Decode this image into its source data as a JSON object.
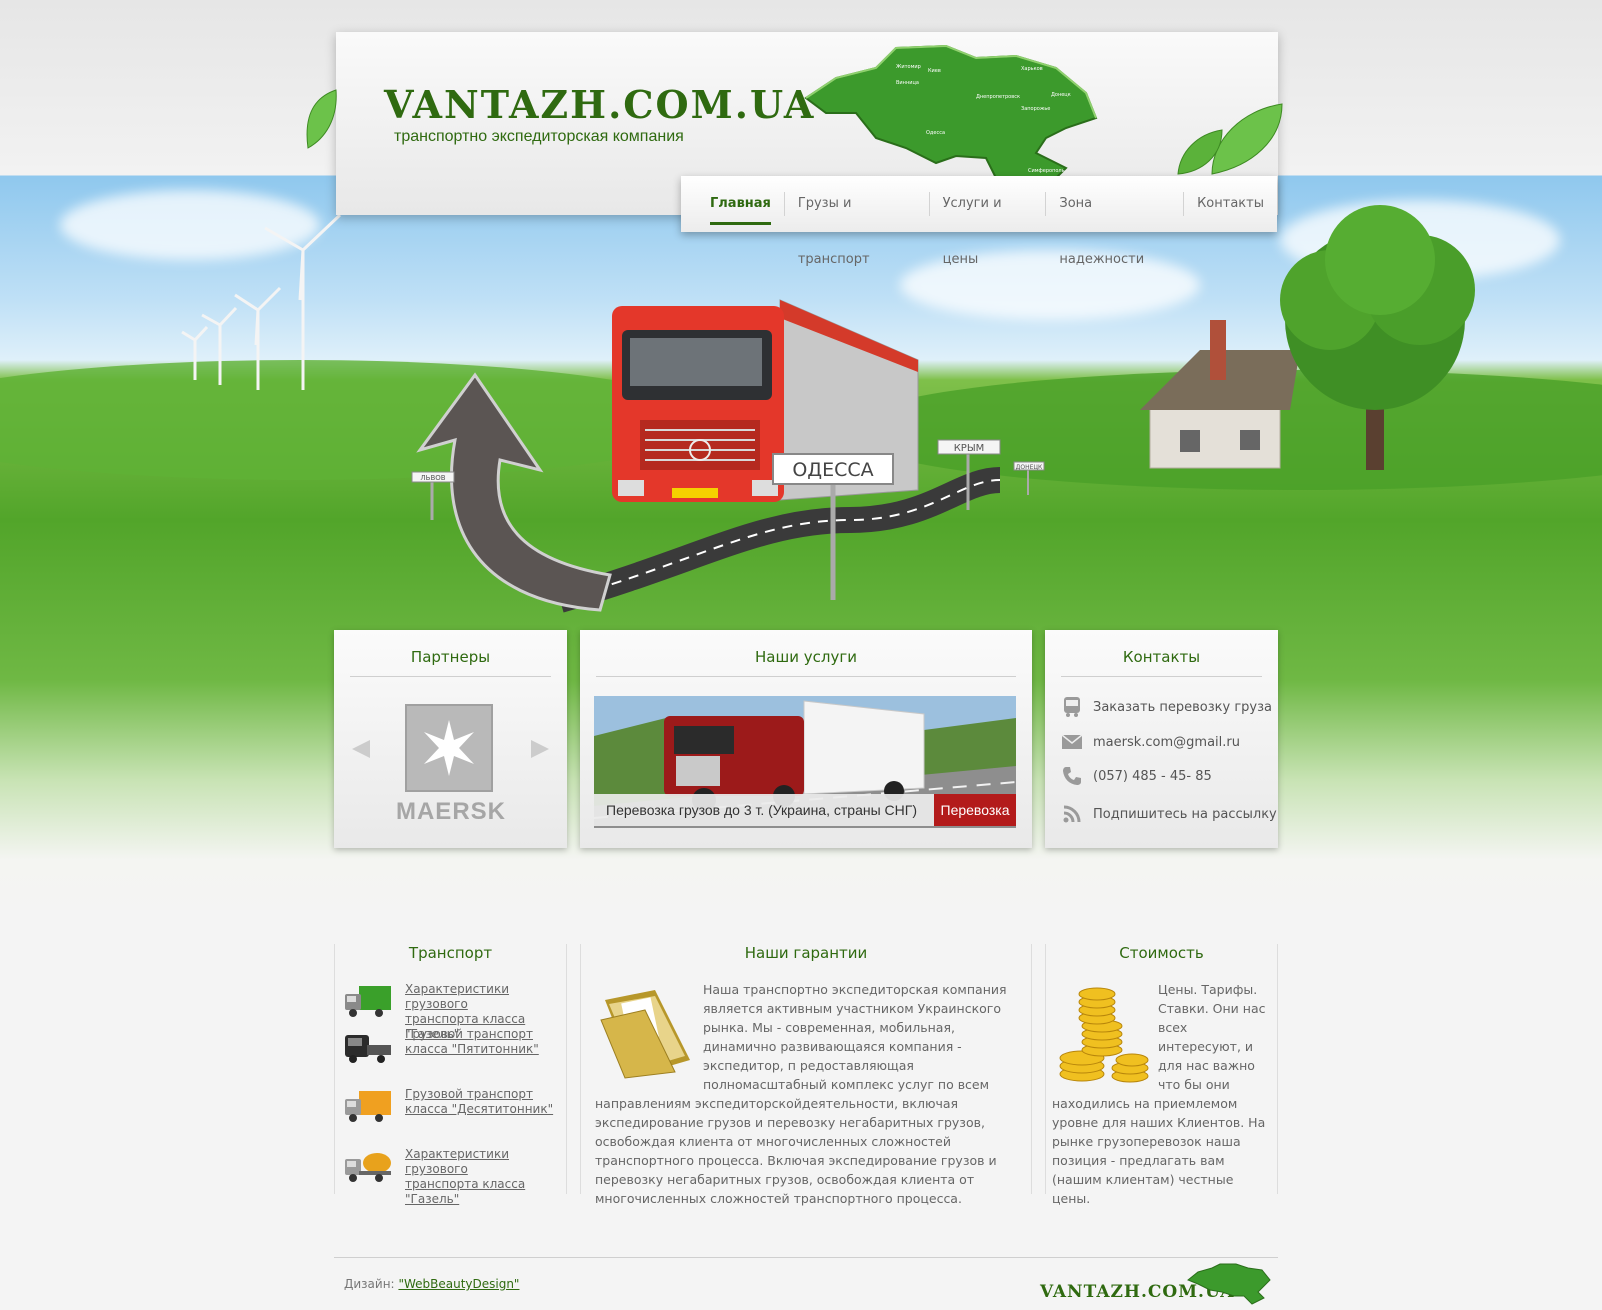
{
  "header": {
    "logo": "VANTAZH.COM.UA",
    "tagline": "транспортно экспедиторская компания",
    "map_labels": [
      "Житомир",
      "Киев",
      "Винница",
      "Одесса",
      "Днепропетровск",
      "Запорожье",
      "Донецк",
      "Харьков",
      "Симферополь"
    ]
  },
  "nav": {
    "items": [
      "Главная",
      "Грузы и транспорт",
      "Услуги и цены",
      "Зона надежности",
      "Контакты"
    ],
    "active_index": 0
  },
  "hero": {
    "sign_main": "ОДЕССА",
    "sign_right": "КРЫМ",
    "sign_left": "ЛЬВОВ",
    "sign_far": "ДОНЕЦК"
  },
  "partners": {
    "title": "Партнеры",
    "brand": "MAERSK"
  },
  "services": {
    "title": "Наши услуги",
    "caption": "Перевозка грузов до 3 т. (Украина, страны СНГ)",
    "tag": "Перевозка"
  },
  "contacts": {
    "title": "Контакты",
    "order": "Заказать перевозку груза",
    "email": "maersk.com@gmail.ru",
    "phone": "(057) 485 - 45- 85",
    "subscribe": "Подпишитесь на рассылку"
  },
  "transport": {
    "title": "Транспорт",
    "items": [
      {
        "line1": "Характеристики грузового",
        "line2": "транспорта класса \"Газель\"",
        "color": "#3aa02a"
      },
      {
        "line1": "Грузовой транспорт",
        "line2": "класса \"Пятитонник\"",
        "color": "#333333"
      },
      {
        "line1": "Грузовой транспорт",
        "line2": "класса \"Десятитонник\"",
        "color": "#f0a020"
      },
      {
        "line1": "Характеристики грузового",
        "line2": "транспорта класса \"Газель\"",
        "color": "#e8a21c"
      }
    ]
  },
  "guarantees": {
    "title": "Наши гарантии",
    "text": "Наша транспортно экспедиторская компания является активным участником Украинского рынка. Мы - современная, мобильная, динамично развивающаяся компания - экспедитор, п редоставляющая полномасштабный комплекс услуг по всем направлениям экспедиторскойдеятельности, включая экспедирование грузов и перевозку негабаритных грузов, освобождая клиента от многочисленных сложностей транспортного процесса. Включая экспедирование грузов и перевозку негабаритных грузов, освобождая клиента от многочисленных сложностей транспортного процесса."
  },
  "cost": {
    "title": "Стоимость",
    "text": "Цены. Тарифы. Ставки. Они нас всех интересуют, и для нас важно что бы они находились на приемлемом уровне для наших Клиентов. На рынке грузоперевозок наша позиция - предлагать вам (нашим клиентам) честные цены."
  },
  "footer": {
    "design_label": "Дизайн:",
    "design_link": "\"WebBeautyDesign\"",
    "logo": "VANTAZH.COM.UA"
  },
  "colors": {
    "brand_green": "#2f6a10",
    "accent_red": "#b31b1b"
  }
}
